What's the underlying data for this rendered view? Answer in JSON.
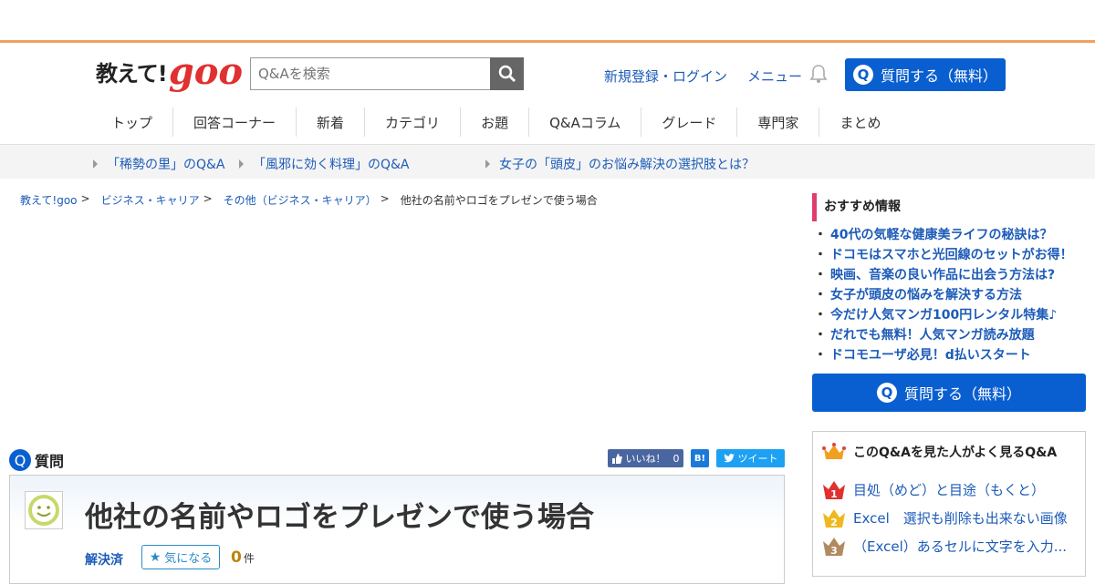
{
  "header": {
    "logo_text": "教えて!",
    "logo_goo": "goo",
    "search_placeholder": "Q&Aを検索",
    "login_link": "新規登録・ログイン",
    "menu_link": "メニュー",
    "ask_button": "質問する（無料）",
    "q_letter": "Q"
  },
  "gnav": [
    "トップ",
    "回答コーナー",
    "新着",
    "カテゴリ",
    "お題",
    "Q&Aコラム",
    "グレード",
    "専門家",
    "まとめ"
  ],
  "subnav": [
    "「稀勢の里」のQ&A",
    "「風邪に効く料理」のQ&A",
    "女子の「頭皮」のお悩み解決の選択肢とは？"
  ],
  "breadcrumb": {
    "home": "教えて!goo",
    "cat1": "ビジネス・キャリア",
    "cat2": "その他（ビジネス・キャリア）",
    "current": "他社の名前やロゴをプレゼンで使う場合",
    "sep": ">"
  },
  "question": {
    "section_label": "質問",
    "q_letter": "Q",
    "title": "他社の名前やロゴをプレゼンで使う場合",
    "status": "解決済",
    "watch_label": "気になる",
    "count": "0",
    "count_unit": "件"
  },
  "social": {
    "like_label": "いいね！",
    "like_count": "0",
    "hatena_label": "B!",
    "tweet_label": "ツイート"
  },
  "sidebar": {
    "rec_title": "おすすめ情報",
    "rec_items": [
      "40代の気軽な健康美ライフの秘訣は？",
      "ドコモはスマホと光回線のセットがお得！",
      "映画、音楽の良い作品に出会う方法は?",
      "女子が頭皮の悩みを解決する方法",
      "今だけ人気マンガ100円レンタル特集♪",
      "だれでも無料！人気マンガ読み放題",
      "ドコモユーザ必見！d払いスタート"
    ],
    "ask_button": "質問する（無料）",
    "q_letter": "Q",
    "rank_title": "このQ&Aを見た人がよく見るQ&A",
    "rank_items": [
      "目処（めど）と目途（もくと）",
      "Excel　選択も削除も出来ない画像",
      "（Excel）あるセルに文字を入力..."
    ],
    "rank_numbers": [
      "1",
      "2",
      "3"
    ]
  },
  "colors": {
    "brand_blue": "#0a5fd0",
    "link_blue": "#1c5bb8",
    "logo_red": "#e03030",
    "accent_pink": "#e23c6a",
    "top_bar_orange": "#f0a060"
  }
}
